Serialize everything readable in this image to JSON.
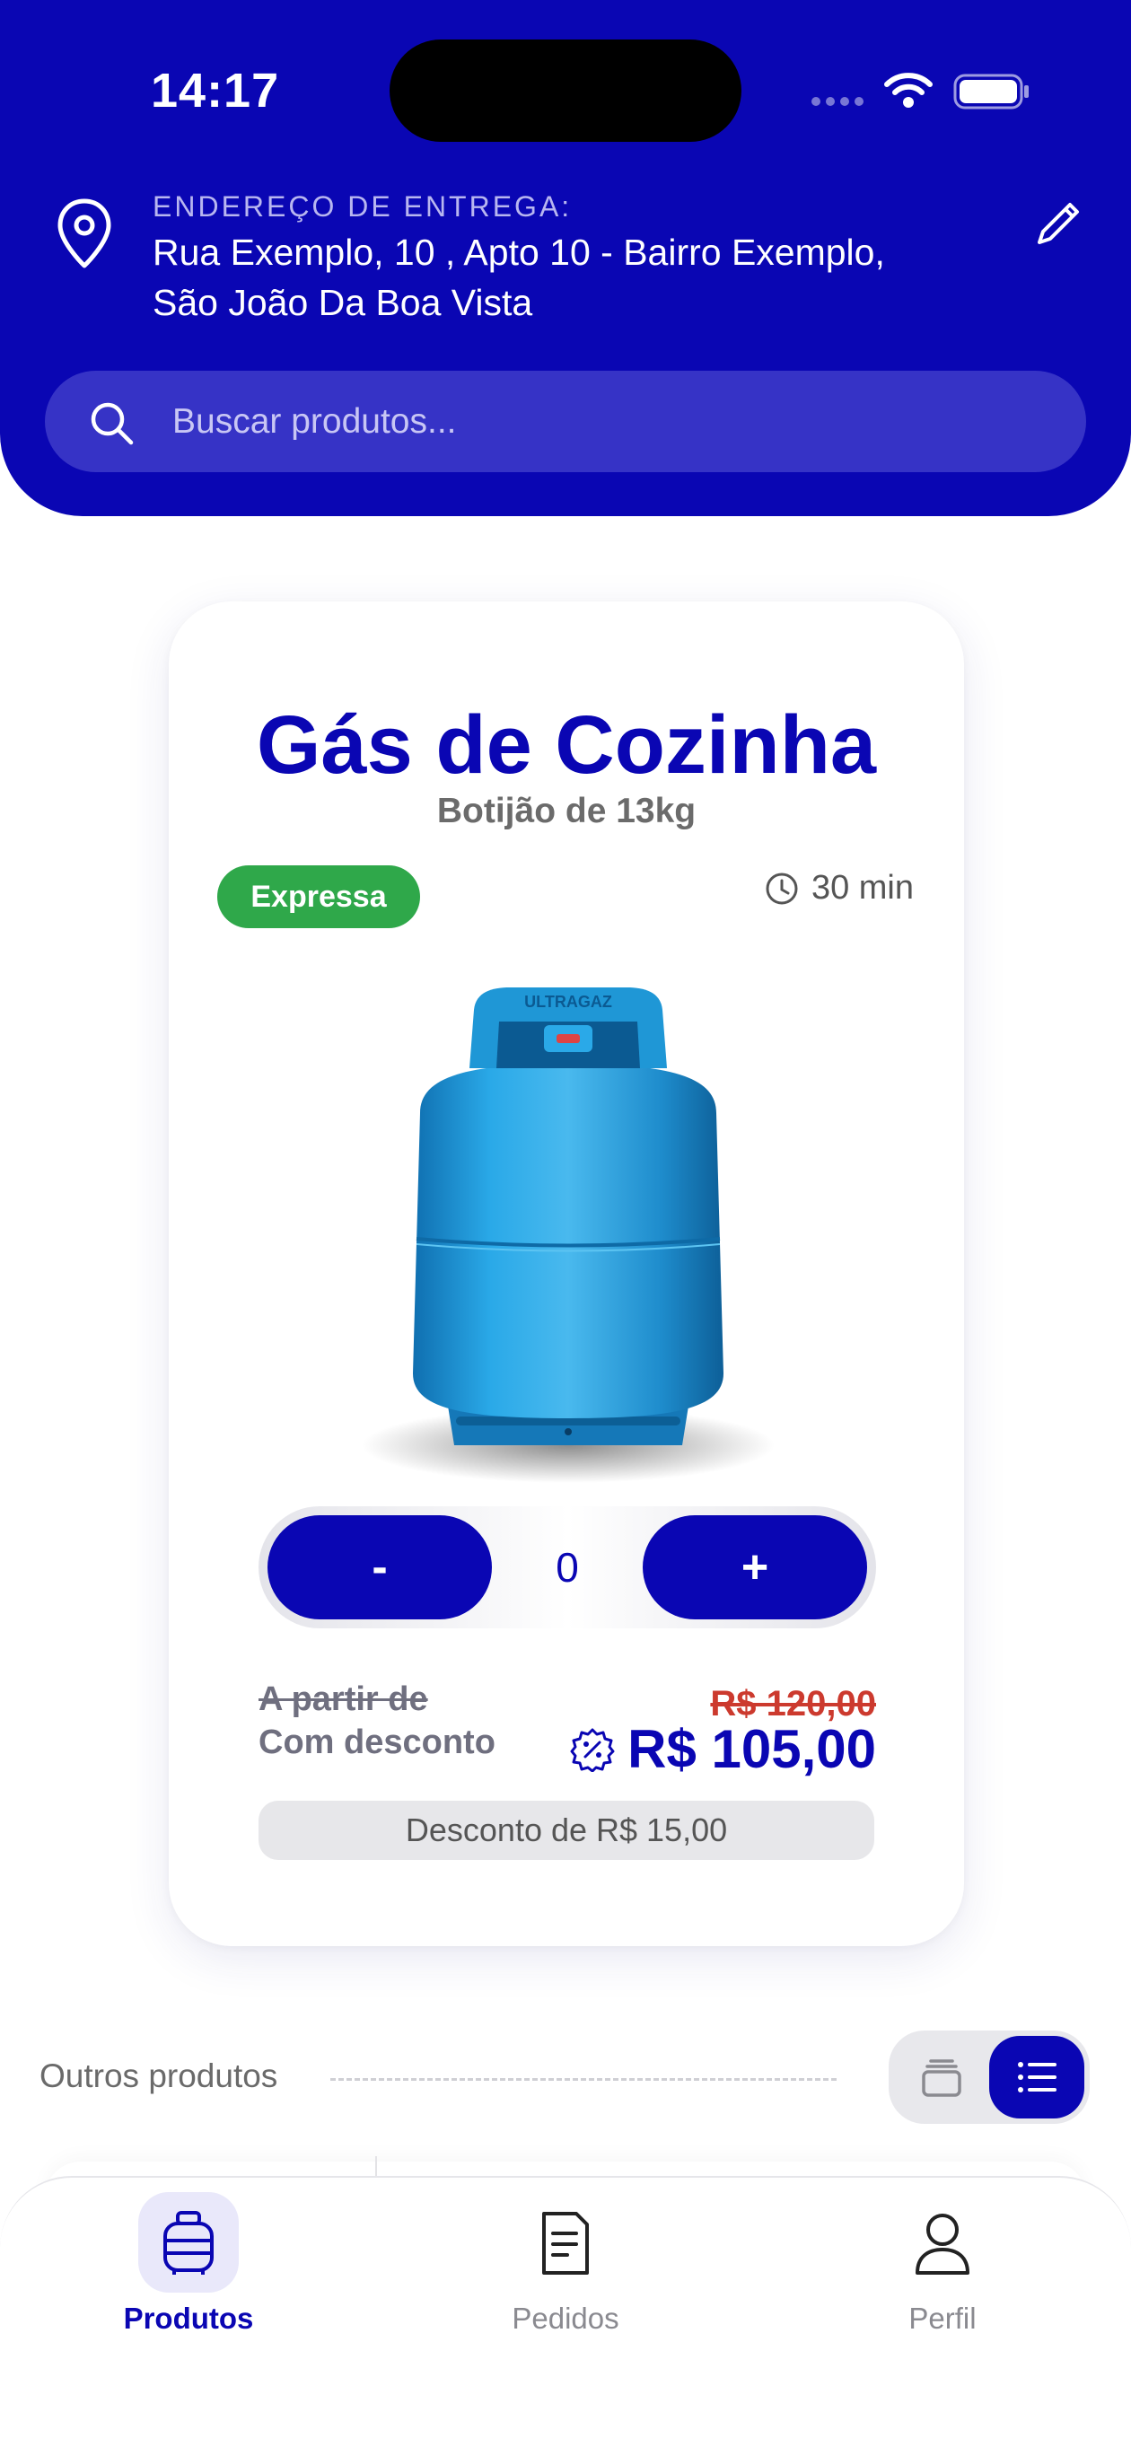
{
  "status_bar": {
    "time": "14:17"
  },
  "header": {
    "address_label": "ENDEREÇO DE ENTREGA:",
    "address_line1": "Rua Exemplo, 10 , Apto 10 - Bairro Exemplo,",
    "address_line2": "São João Da Boa Vista",
    "search_placeholder": "Buscar produtos..."
  },
  "product": {
    "title": "Gás de Cozinha",
    "subtitle": "Botijão de 13kg",
    "badge": "Expressa",
    "delivery_time": "30 min",
    "quantity": "0",
    "minus_label": "-",
    "plus_label": "+",
    "from_label": "A partir de",
    "discount_label": "Com desconto",
    "old_price": "R$ 120,00",
    "new_price": "R$ 105,00",
    "discount_text": "Desconto de R$ 15,00"
  },
  "other_products": {
    "label": "Outros produtos"
  },
  "bottom_nav": {
    "items": [
      {
        "label": "Produtos",
        "icon": "gas-cylinder-icon",
        "active": true
      },
      {
        "label": "Pedidos",
        "icon": "document-icon",
        "active": false
      },
      {
        "label": "Perfil",
        "icon": "person-icon",
        "active": false
      }
    ]
  },
  "colors": {
    "brand_blue": "#0a06b3",
    "badge_green": "#2fa84a",
    "old_price_red": "#cc3a2e",
    "cylinder_blue": "#1e9bd7"
  }
}
